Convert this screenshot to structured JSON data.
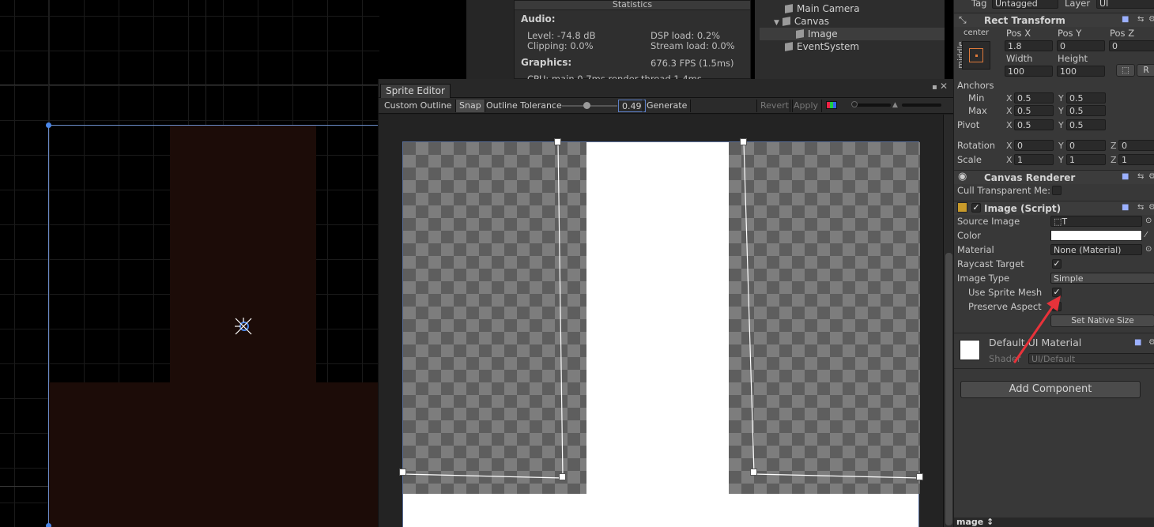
{
  "statistics": {
    "title": "Statistics",
    "audio_label": "Audio:",
    "level": "Level: -74.8 dB",
    "clipping": "Clipping: 0.0%",
    "dsp": "DSP load: 0.2%",
    "stream": "Stream load: 0.0%",
    "graphics_label": "Graphics:",
    "fps": "676.3 FPS (1.5ms)",
    "cpu": "CPU: main 0.7ms  render thread 1.4ms"
  },
  "hierarchy": {
    "items": [
      "Main Camera",
      "Canvas",
      "Image",
      "EventSystem"
    ],
    "expand_glyph": "▼"
  },
  "sprite_editor": {
    "tab_label": "Sprite Editor",
    "mode": "Custom Outline ↕",
    "snap": "Snap",
    "tolerance_label": "Outline Tolerance",
    "tolerance_value": "0.49",
    "generate": "Generate",
    "revert": "Revert",
    "apply": "Apply"
  },
  "inspector": {
    "tag_label": "Tag",
    "tag_value": "Untagged",
    "layer_label": "Layer",
    "layer_value": "UI",
    "rect_transform": {
      "title": "Rect Transform",
      "anchor_label": "center",
      "anchor_side": "middle",
      "pos_x_label": "Pos X",
      "pos_y_label": "Pos Y",
      "pos_z_label": "Pos Z",
      "pos_x": "1.8",
      "pos_y": "0",
      "pos_z": "0",
      "width_label": "Width",
      "height_label": "Height",
      "width": "100",
      "height": "100",
      "raw_btn": "R",
      "anchors_label": "Anchors",
      "min_label": "Min",
      "max_label": "Max",
      "min_x": "0.5",
      "min_y": "0.5",
      "max_x": "0.5",
      "max_y": "0.5",
      "pivot_label": "Pivot",
      "pivot_x": "0.5",
      "pivot_y": "0.5",
      "rotation_label": "Rotation",
      "rot_x": "0",
      "rot_y": "0",
      "rot_z": "0",
      "scale_label": "Scale",
      "scale_x": "1",
      "scale_y": "1",
      "scale_z": "1",
      "x": "X",
      "y": "Y",
      "z": "Z"
    },
    "canvas_renderer": {
      "title": "Canvas Renderer",
      "cull_label": "Cull Transparent Me:"
    },
    "image_script": {
      "title": "Image (Script)",
      "source_image_label": "Source Image",
      "source_image_value": "T",
      "color_label": "Color",
      "material_label": "Material",
      "material_value": "None (Material)",
      "raycast_label": "Raycast Target",
      "image_type_label": "Image Type",
      "image_type_value": "Simple",
      "use_sprite_mesh_label": "Use Sprite Mesh",
      "preserve_aspect_label": "Preserve Aspect",
      "native_size_btn": "Set Native Size"
    },
    "material_block": {
      "name": "Default UI Material",
      "shader_label": "Shader",
      "shader_value": "UI/Default"
    },
    "add_component": "Add Component",
    "bottom_label": "mage ↕"
  },
  "colors": {
    "accent_blue": "#4a86e8",
    "arrow_red": "#e8323a",
    "sprite_dark": "#1c0c08"
  }
}
